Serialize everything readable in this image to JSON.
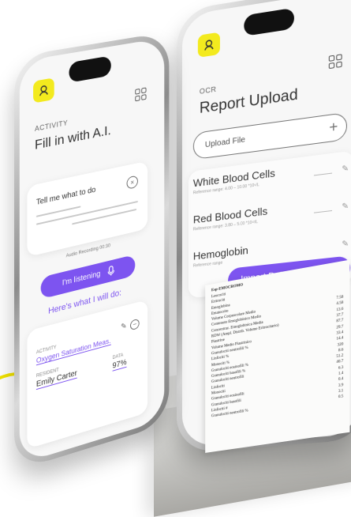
{
  "left_screen": {
    "section_label": "ACTIVITY",
    "title": "Fill in with A.I.",
    "prompt_card": {
      "prompt_text": "Tell me what to do",
      "audio_caption": "Audio Recording 00:30"
    },
    "listening_button": "I'm listening",
    "plan_heading": "Here's what I will do:",
    "result_card": {
      "activity_label": "ACTIVITY",
      "activity_value": "Oxygen Saturation Meas.",
      "resident_label": "RESIDENT",
      "resident_value": "Emily Carter",
      "data_label": "DATA",
      "data_value": "97%"
    }
  },
  "right_screen": {
    "section_label": "OCR",
    "title": "Report Upload",
    "upload_placeholder": "Upload File",
    "reports": [
      {
        "name": "White Blood Cells",
        "reference": "Reference range: 4.00 – 10.00 *10⁹/L"
      },
      {
        "name": "Red Blood Cells",
        "reference": "Reference range: 3.80 – 5.00 *10¹²/L"
      },
      {
        "name": "Hemoglobin",
        "reference": "Reference range"
      }
    ],
    "import_button": "Import Data"
  },
  "paper": {
    "header": "Esp-EMOCROMO",
    "rows": [
      {
        "label": "Leucociti",
        "value": ""
      },
      {
        "label": "Eritrociti",
        "value": ""
      },
      {
        "label": "Emoglobina",
        "value": ""
      },
      {
        "label": "Ematocrito",
        "value": ""
      },
      {
        "label": "Volume Corpuscolare Medio",
        "value": "7.58"
      },
      {
        "label": "Contenuto Emoglobinico Medio",
        "value": "4.58"
      },
      {
        "label": "Concentraz. Emoglobinica Media",
        "value": "13.6"
      },
      {
        "label": "RDW (Ampl. Distrib. Volume Eritrocitario)",
        "value": "37.7"
      },
      {
        "label": "Piastrine",
        "value": "87.7"
      },
      {
        "label": "Volume Medio Piastrinico",
        "value": "29.7"
      },
      {
        "label": "Granulociti neutrofili %",
        "value": "33.4"
      },
      {
        "label": "Linfociti %",
        "value": "14.4"
      },
      {
        "label": "Monociti %",
        "value": "320"
      },
      {
        "label": "Granulociti eosinofili %",
        "value": "8.6"
      },
      {
        "label": "Granulociti basofili %",
        "value": "51.2"
      },
      {
        "label": "Granulociti neutrofili",
        "value": "40.7"
      },
      {
        "label": "Linfociti",
        "value": "6.3"
      },
      {
        "label": "Monociti",
        "value": "1.4"
      },
      {
        "label": "Granulociti eosinofili",
        "value": "0.4"
      },
      {
        "label": "Granulociti basofili",
        "value": "3.9"
      },
      {
        "label": "Linfociti #",
        "value": "3.1"
      },
      {
        "label": "Granulociti neutrofili %",
        "value": "0.5"
      }
    ]
  },
  "colors": {
    "accent_purple": "#7d54f0",
    "accent_yellow": "#f3ea1e"
  }
}
